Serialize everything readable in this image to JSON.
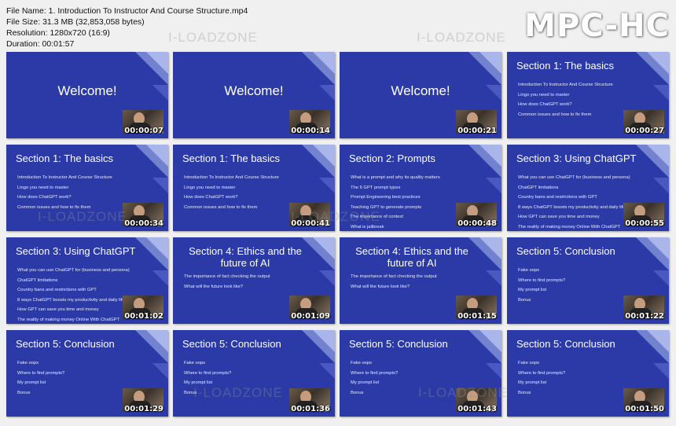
{
  "info": {
    "file_name": "File Name: 1. Introduction To Instructor And Course Structure.mp4",
    "file_size": "File Size: 31.3 MB (32,853,058 bytes)",
    "resolution": "Resolution: 1280x720 (16:9)",
    "duration": "Duration: 00:01:57"
  },
  "logo": "MPC-HC",
  "watermark": "I-LOADZONE",
  "thumbs": [
    {
      "title": "Welcome!",
      "bullets": [],
      "time": "00:00:07"
    },
    {
      "title": "Welcome!",
      "bullets": [],
      "time": "00:00:14"
    },
    {
      "title": "Welcome!",
      "bullets": [],
      "time": "00:00:21"
    },
    {
      "title": "Section 1: The basics",
      "bullets": [
        "Introduction To Instructor And Course Structure",
        "Lingo you need to master",
        "How does ChatGPT work?",
        "Common issues and how to fix them"
      ],
      "time": "00:00:27"
    },
    {
      "title": "Section 1: The basics",
      "bullets": [
        "Introduction To Instructor And Course Structure",
        "Lingo you need to master",
        "How does ChatGPT work?",
        "Common issues and how to fix them"
      ],
      "time": "00:00:34"
    },
    {
      "title": "Section 1: The basics",
      "bullets": [
        "Introduction To Instructor And Course Structure",
        "Lingo you need to master",
        "How does ChatGPT work?",
        "Common issues and how to fix them"
      ],
      "time": "00:00:41"
    },
    {
      "title": "Section 2: Prompts",
      "bullets": [
        "What is a prompt and why its quality matters",
        "The 6 GPT prompt types",
        "Prompt Engineering best practices",
        "Teaching GPT to generate prompts",
        "The importance of context",
        "What is jailbreak"
      ],
      "time": "00:00:48"
    },
    {
      "title": "Section 3: Using ChatGPT",
      "bullets": [
        "What you can use ChatGPT for (business and persona)",
        "ChatGPT limitations",
        "Country bans and restrictions with GPT",
        "8 ways ChatGPT boosts my productivity and daily life",
        "How GPT can save you time and money",
        "The reality of making money Online With ChatGPT"
      ],
      "time": "00:00:55"
    },
    {
      "title": "Section 3: Using ChatGPT",
      "bullets": [
        "What you can use ChatGPT for (business and persona)",
        "ChatGPT limitations",
        "Country bans and restrictions with GPT",
        "8 ways ChatGPT boosts my productivity and daily life",
        "How GPT can save you time and money",
        "The reality of making money Online With ChatGPT"
      ],
      "time": "00:01:02"
    },
    {
      "title": "Section 4: Ethics and the future of AI",
      "bullets": [
        "The importance of fact checking the output",
        "What will the future look like?"
      ],
      "time": "00:01:09"
    },
    {
      "title": "Section 4: Ethics and the future of AI",
      "bullets": [
        "The importance of fact checking the output",
        "What will the future look like?"
      ],
      "time": "00:01:15"
    },
    {
      "title": "Section 5: Conclusion",
      "bullets": [
        "Fake oops",
        "Where to find prompts?",
        "My prompt list",
        "Bonus"
      ],
      "time": "00:01:22"
    },
    {
      "title": "Section 5: Conclusion",
      "bullets": [
        "Fake oops",
        "Where to find prompts?",
        "My prompt list",
        "Bonus"
      ],
      "time": "00:01:29"
    },
    {
      "title": "Section 5: Conclusion",
      "bullets": [
        "Fake oops",
        "Where to find prompts?",
        "My prompt list",
        "Bonus"
      ],
      "time": "00:01:36"
    },
    {
      "title": "Section 5: Conclusion",
      "bullets": [
        "Fake oops",
        "Where to find prompts?",
        "My prompt list",
        "Bonus"
      ],
      "time": "00:01:43"
    },
    {
      "title": "Section 5: Conclusion",
      "bullets": [
        "Fake oops",
        "Where to find prompts?",
        "My prompt list",
        "Bonus"
      ],
      "time": "00:01:50"
    }
  ]
}
